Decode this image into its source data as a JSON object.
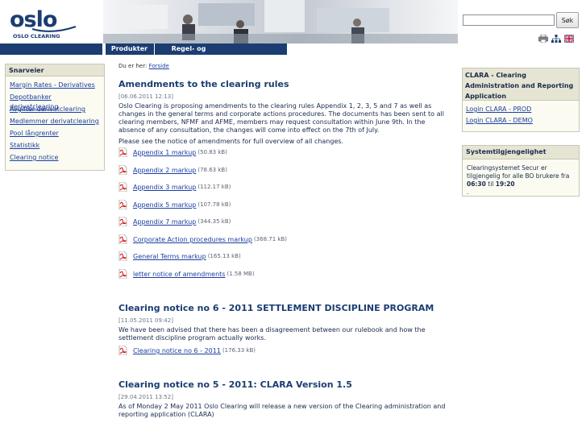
{
  "header": {
    "logo_text": "oslo",
    "logo_subtitle": "OSLO CLEARING",
    "search_placeholder": "",
    "search_button": "Søk",
    "tool_icons": [
      "print-icon",
      "sitemap-icon",
      "uk-flag-icon"
    ]
  },
  "nav": {
    "items": [
      {
        "label": "Produkter"
      },
      {
        "label": "Regel- og avtaleverk"
      }
    ]
  },
  "sidebar": {
    "title": "Snarveier",
    "items": [
      {
        "label": "Margin Rates - Derivatives"
      },
      {
        "label": "Depotbanker derivatclearing"
      },
      {
        "label": "Avgifter derivatclearing"
      },
      {
        "label": "Medlemmer derivatclearing"
      },
      {
        "label": "Pool långrenter"
      },
      {
        "label": "Statistikk"
      },
      {
        "label": "Clearing notice"
      }
    ]
  },
  "breadcrumb": {
    "prefix": "Du er her:",
    "link": "Forside"
  },
  "articles": [
    {
      "title": "Amendments to the clearing rules",
      "date": "[06.06.2011 12:13]",
      "text": "Oslo Clearing is proposing amendments to the clearing rules Appendix 1, 2, 3, 5 and 7 as well as clearing members, NFMF and AFME, members may request consultation within June 9th. In the absence of any consultation, the changes will come into effect on the 7th of July.",
      "text_full": "Oslo Clearing is proposing amendments to the clearing rules Appendix 1, 2, 3, 5 and 7 as well as changes in the general terms and corporate actions procedures. The documents has been sent to all clearing members, NFMF and AFME, members may request consultation within June 9th. In the absence of any consultation, the changes will come into effect on the 7th of July.",
      "text2": "Please see the notice of amendments for full overview of all changes.",
      "files": [
        {
          "name": "Appendix 1 markup",
          "size": "(50.83 kB)"
        },
        {
          "name": "Appendix 2 markup",
          "size": "(78.63 kB)"
        },
        {
          "name": "Appendix 3 markup",
          "size": "(112.17 kB)"
        },
        {
          "name": "Appendix 5 markup",
          "size": "(107.78 kB)"
        },
        {
          "name": "Appendix 7 markup",
          "size": "(344.35 kB)"
        },
        {
          "name": "Corporate Action procedures markup",
          "size": "(368.71 kB)"
        },
        {
          "name": "General Terms markup",
          "size": "(165.13 kB)"
        },
        {
          "name": "letter notice of amendments",
          "size": "(1.58 MB)"
        }
      ]
    },
    {
      "title": "Clearing notice no 6 - 2011 SETTLEMENT DISCIPLINE PROGRAM",
      "date": "[11.05.2011 09:42]",
      "text": "We have been advised that there has been a disagreement between our rulebook and how the settlement discipline program actually works.",
      "files": [
        {
          "name": "Clearing notice no 6 - 2011",
          "size": "(176.33 kB)"
        }
      ]
    },
    {
      "title": "Clearing notice no 5 - 2011: CLARA Version 1.5",
      "date": "[29.04.2011 13:52]",
      "text": "As of Monday 2 May  2011 Oslo Clearing will release a new version of the Clearing administration and reporting application (CLARA)"
    }
  ],
  "clara": {
    "title": "CLARA - Clearing Administration and Reporting Application",
    "links": [
      {
        "label": "Login CLARA - PROD"
      },
      {
        "label": "Login CLARA - DEMO"
      }
    ]
  },
  "system": {
    "title": "Systemtilgjengelighet",
    "text_a": "Clearingsystemet Secur er tilgjengelig for alle BO brukere fra ",
    "time_from": "06:30",
    "text_b": " til ",
    "time_to": "19:20",
    "text_c": "."
  },
  "colors": {
    "nav_bg": "#1b3d72",
    "title": "#1b3d72",
    "link": "#1a3fa0",
    "box_bg": "#fbfbf2",
    "box_head": "#e6e5d3"
  }
}
